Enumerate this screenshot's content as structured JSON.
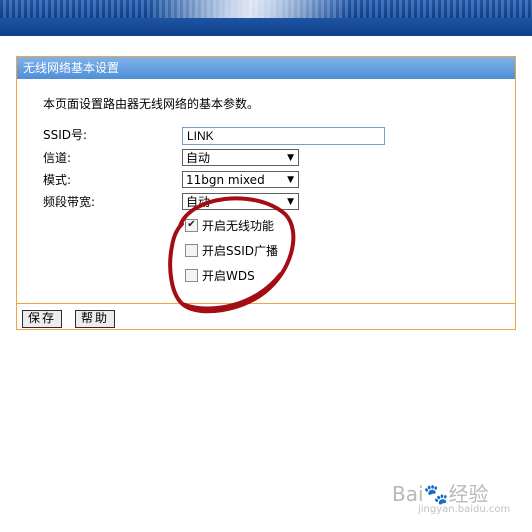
{
  "panel": {
    "title": "无线网络基本设置",
    "description": "本页面设置路由器无线网络的基本参数。"
  },
  "fields": {
    "ssid_label": "SSID号:",
    "ssid_value": "LINK",
    "channel_label": "信道:",
    "channel_value": "自动",
    "mode_label": "模式:",
    "mode_value": "11bgn mixed",
    "bandwidth_label": "频段带宽:",
    "bandwidth_value": "自动"
  },
  "checkboxes": [
    {
      "label": "开启无线功能",
      "checked": true
    },
    {
      "label": "开启SSID广播",
      "checked": false
    },
    {
      "label": "开启WDS",
      "checked": false
    }
  ],
  "buttons": {
    "save": "保存",
    "help": "帮助"
  },
  "watermark": {
    "brand": "Bai",
    "brand_suffix": "经验",
    "url": "jingyan.baidu.com"
  }
}
